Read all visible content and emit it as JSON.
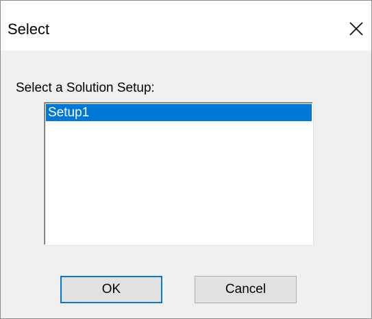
{
  "window": {
    "title": "Select"
  },
  "icons": {
    "close": "close-icon"
  },
  "dialog": {
    "prompt": "Select a Solution Setup:",
    "list_items": [
      {
        "label": "Setup1",
        "selected": true
      }
    ],
    "buttons": {
      "ok_label": "OK",
      "cancel_label": "Cancel"
    }
  },
  "colors": {
    "selection": "#0078d7",
    "dialog_bg": "#f0f0f0",
    "button_bg": "#e1e1e1"
  }
}
